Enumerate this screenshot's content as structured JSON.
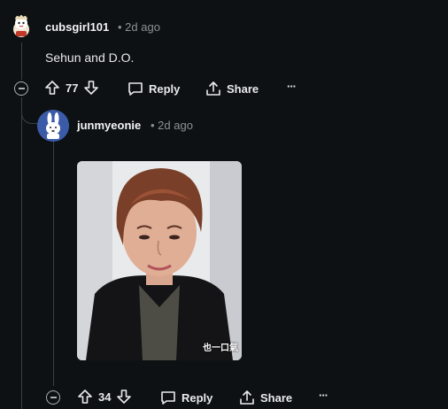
{
  "comment1": {
    "username": "cubsgirl101",
    "time": "• 2d ago",
    "body": "Sehun and D.O.",
    "votes": "77",
    "reply_label": "Reply",
    "share_label": "Share",
    "more_label": "···"
  },
  "comment2": {
    "username": "junmyeonie",
    "time": "• 2d ago",
    "gif_caption": "也一口氣",
    "votes": "34",
    "reply_label": "Reply",
    "share_label": "Share",
    "more_label": "···"
  },
  "colors": {
    "background": "#0e1113",
    "text": "#e8eaec",
    "muted": "#8c9296"
  }
}
